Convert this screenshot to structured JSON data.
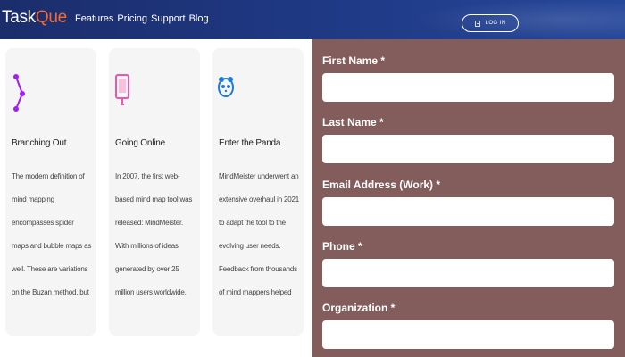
{
  "header": {
    "logo_text_1": "Task",
    "logo_text_2": "Que",
    "nav_links": [
      "Features",
      "Pricing",
      "Support",
      "Blog"
    ],
    "login_label": "LOG IN"
  },
  "cards": [
    {
      "icon": "branch-icon",
      "icon_color": "#a020f0",
      "title": "Branching Out",
      "text": "The modern definition of mind mapping encompasses spider maps and bubble maps as well. These are variations on the Buzan method, but maintain the radial structure and hierarchy of mind maps."
    },
    {
      "icon": "tablet-icon",
      "icon_color": "#e85aa8",
      "title": "Going Online",
      "text": "In 2007, the first web-based mind map tool was released: MindMeister. With millions of ideas generated by over 25 million users worldwide, the tool has become a standard for business and education."
    },
    {
      "icon": "panda-icon",
      "icon_color": "#1f7bd6",
      "title": "Enter the Panda",
      "text": "MindMeister underwent an extensive overhaul in 2021 to adapt the tool to the evolving user needs. Feedback from thousands of mind mappers helped create an all-new MindMeister - Project Panda."
    }
  ],
  "form": {
    "fields": [
      {
        "label": "First Name *",
        "value": ""
      },
      {
        "label": "Last Name *",
        "value": ""
      },
      {
        "label": "Email Address (Work) *",
        "value": ""
      },
      {
        "label": "Phone *",
        "value": ""
      },
      {
        "label": "Organization *",
        "value": ""
      }
    ]
  },
  "colors": {
    "header_bg": "#1f3a86",
    "form_bg": "#825d5b",
    "logo_accent": "#f06b3a"
  }
}
